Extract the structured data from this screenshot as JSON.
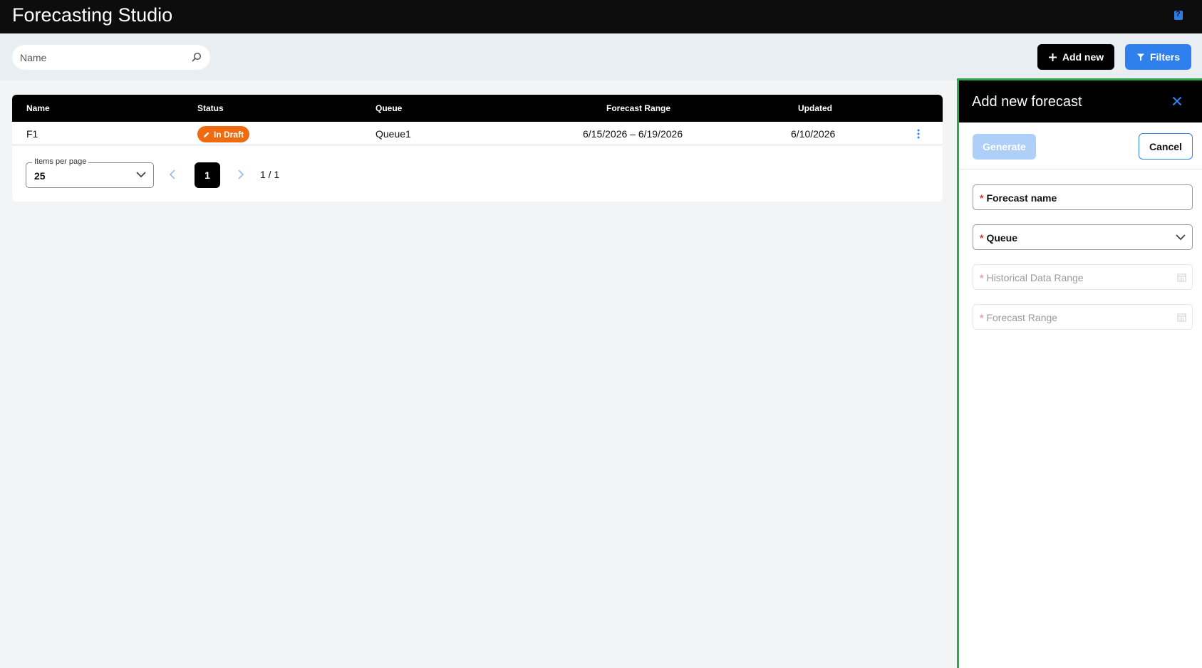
{
  "app": {
    "title": "Forecasting Studio"
  },
  "toolbar": {
    "search_placeholder": "Name",
    "add_new_label": "Add new",
    "filters_label": "Filters"
  },
  "table": {
    "columns": [
      "Name",
      "Status",
      "Queue",
      "Forecast Range",
      "Updated"
    ],
    "rows": [
      {
        "name": "F1",
        "status": "In Draft",
        "queue": "Queue1",
        "forecast_range": "6/15/2026 – 6/19/2026",
        "updated": "6/10/2026"
      }
    ]
  },
  "pagination": {
    "items_per_page_label": "Items per page",
    "items_per_page": "25",
    "current_page": "1",
    "page_info": "1 / 1"
  },
  "panel": {
    "title": "Add new forecast",
    "generate_label": "Generate",
    "cancel_label": "Cancel",
    "fields": {
      "forecast_name": "Forecast name",
      "queue": "Queue",
      "historical_range": "Historical Data Range",
      "forecast_range": "Forecast Range"
    }
  },
  "colors": {
    "accent": "#2f80ed",
    "draft_badge": "#f06a0f",
    "panel_outline": "#2ea84a"
  }
}
